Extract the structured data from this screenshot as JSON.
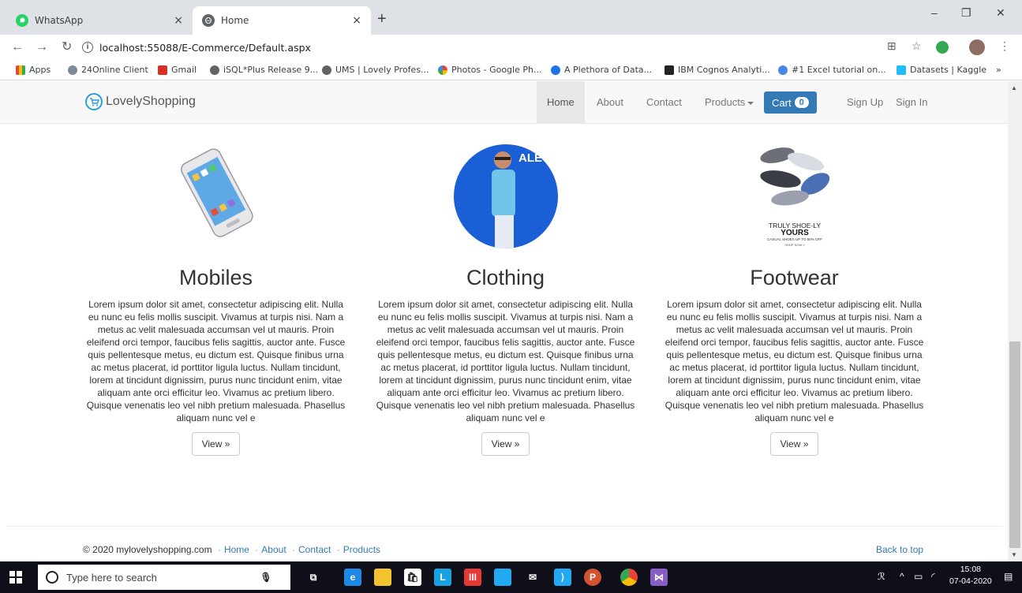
{
  "browser": {
    "tabs": [
      {
        "title": "WhatsApp",
        "close": "×"
      },
      {
        "title": "Home",
        "close": "×"
      }
    ],
    "new_tab": "+",
    "window_controls": {
      "minimize": "–",
      "restore": "❐",
      "close": "✕"
    },
    "url": "localhost:55088/E-Commerce/Default.aspx",
    "bookmarks": [
      {
        "label": "Apps",
        "color": "#e8453c"
      },
      {
        "label": "24Online Client",
        "color": "#7d8a99"
      },
      {
        "label": "Gmail",
        "color": "#d93025"
      },
      {
        "label": "iSQL*Plus Release 9...",
        "color": "#5f6368"
      },
      {
        "label": "UMS | Lovely Profes...",
        "color": "#5f6368"
      },
      {
        "label": "Photos - Google Ph...",
        "color": "#fbbc04"
      },
      {
        "label": "A Plethora of Data...",
        "color": "#1a73e8"
      },
      {
        "label": "IBM Cognos Analyti...",
        "color": "#222222"
      },
      {
        "label": "#1 Excel tutorial on...",
        "color": "#4a86e8"
      },
      {
        "label": "Datasets | Kaggle",
        "color": "#20beff"
      }
    ],
    "bookmarks_more": "»"
  },
  "site": {
    "brand": "LovelyShopping",
    "nav": {
      "home": "Home",
      "about": "About",
      "contact": "Contact",
      "products": "Products",
      "cart": "Cart",
      "cart_count": "0",
      "signup": "Sign Up",
      "signin": "Sign In"
    },
    "categories": [
      {
        "title": "Mobiles",
        "text": "Lorem ipsum dolor sit amet, consectetur adipiscing elit. Nulla eu nunc eu felis mollis suscipit. Vivamus at turpis nisi. Nam a metus ac velit malesuada accumsan vel ut mauris. Proin eleifend orci tempor, faucibus felis sagittis, auctor ante. Fusce quis pellentesque metus, eu dictum est. Quisque finibus urna ac metus placerat, id porttitor ligula luctus. Nullam tincidunt, lorem at tincidunt dignissim, purus nunc tincidunt enim, vitae aliquam ante orci efficitur leo. Vivamus ac pretium libero. Quisque venenatis leo vel nibh pretium malesuada. Phasellus aliquam nunc vel e",
        "button": "View »"
      },
      {
        "title": "Clothing",
        "text": "Lorem ipsum dolor sit amet, consectetur adipiscing elit. Nulla eu nunc eu felis mollis suscipit. Vivamus at turpis nisi. Nam a metus ac velit malesuada accumsan vel ut mauris. Proin eleifend orci tempor, faucibus felis sagittis, auctor ante. Fusce quis pellentesque metus, eu dictum est. Quisque finibus urna ac metus placerat, id porttitor ligula luctus. Nullam tincidunt, lorem at tincidunt dignissim, purus nunc tincidunt enim, vitae aliquam ante orci efficitur leo. Vivamus ac pretium libero. Quisque venenatis leo vel nibh pretium malesuada. Phasellus aliquam nunc vel e",
        "button": "View »",
        "image_text": "ALE"
      },
      {
        "title": "Footwear",
        "text": "Lorem ipsum dolor sit amet, consectetur adipiscing elit. Nulla eu nunc eu felis mollis suscipit. Vivamus at turpis nisi. Nam a metus ac velit malesuada accumsan vel ut mauris. Proin eleifend orci tempor, faucibus felis sagittis, auctor ante. Fusce quis pellentesque metus, eu dictum est. Quisque finibus urna ac metus placerat, id porttitor ligula luctus. Nullam tincidunt, lorem at tincidunt dignissim, purus nunc tincidunt enim, vitae aliquam ante orci efficitur leo. Vivamus ac pretium libero. Quisque venenatis leo vel nibh pretium malesuada. Phasellus aliquam nunc vel e",
        "button": "View »",
        "image_text": [
          "TRULY SHOE-LY",
          "YOURS",
          "CASUAL SHOES UP TO 50% OFF",
          "SHOP NOW »"
        ]
      }
    ],
    "footer": {
      "copyright": "© 2020 mylovelyshopping.com",
      "links": [
        "Home",
        "About",
        "Contact",
        "Products"
      ],
      "separator": "·",
      "back_to_top": "Back to top"
    }
  },
  "taskbar": {
    "search_placeholder": "Type here to search",
    "time": "15:08",
    "date": "07-04-2020",
    "colors": {
      "edge": "#1e88e5",
      "explorer": "#f4c430",
      "store": "#ffffff",
      "launcher": "#1aa1e0",
      "office": "#e53935",
      "vscode": "#23a9f2",
      "powerpoint": "#d35230",
      "chrome": "#4caf50",
      "vs": "#865fc5"
    }
  }
}
